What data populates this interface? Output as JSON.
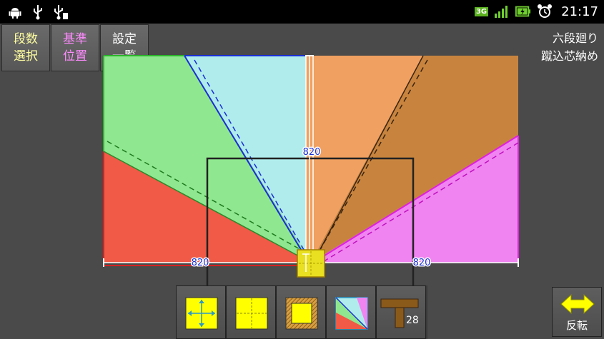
{
  "status_bar": {
    "network": "3G",
    "time": "21:17",
    "left_icons": [
      "android-icon",
      "usb-icon",
      "usb-debug-icon"
    ],
    "right_icons": [
      "signal-icon",
      "battery-charging-icon",
      "alarm-icon"
    ]
  },
  "top_buttons": [
    {
      "line1": "段数",
      "line2": "選択",
      "color": "#ffffa0"
    },
    {
      "line1": "基準",
      "line2": "位置",
      "color": "#ff8cff"
    },
    {
      "line1": "設定",
      "line2": "一覧",
      "color": "#ffffff"
    }
  ],
  "mode": {
    "line1": "六段廻り",
    "line2": "蹴込芯納め"
  },
  "dimensions": {
    "vertical": "820",
    "left": "820",
    "right": "820"
  },
  "toolbar": {
    "offset_value": "28",
    "tools": [
      "center-arrows-tool",
      "center-cross-tool",
      "frame-tool",
      "triangle-tool",
      "beam-tool"
    ]
  },
  "flip_button": {
    "label": "反転"
  },
  "colors": {
    "green": "#8fe88f",
    "cyan": "#b0ecec",
    "orange": "#f0a060",
    "brown": "#c8843e",
    "magenta": "#f084f0",
    "red": "#f05a46",
    "yellow": "#ffff00"
  }
}
